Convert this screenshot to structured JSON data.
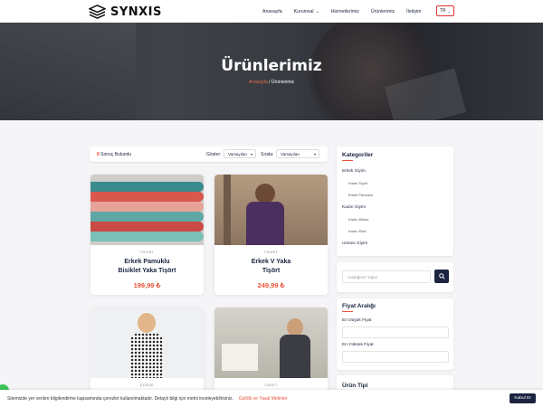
{
  "brand": {
    "name": "SYNXIS"
  },
  "nav": {
    "items": [
      {
        "label": "Anasayfa",
        "dropdown": false
      },
      {
        "label": "Kurumsal",
        "dropdown": true
      },
      {
        "label": "Hizmetlerimiz",
        "dropdown": false
      },
      {
        "label": "Ürünlerimiz",
        "dropdown": false
      },
      {
        "label": "İletişim",
        "dropdown": false
      }
    ],
    "language": "TR"
  },
  "hero": {
    "title": "Ürünlerimiz",
    "breadcrumb_home": "Anasayfa",
    "breadcrumb_sep": "/",
    "breadcrumb_current": "Ürünlerimiz"
  },
  "toolbar": {
    "result_count": "8",
    "result_label": "Sonuç Bulundu",
    "show_label": "Göster:",
    "show_value": "Varsayılan",
    "sort_label": "Sırala:",
    "sort_value": "Varsayılan"
  },
  "products": [
    {
      "category": "TSHIRT",
      "name_line1": "Erkek Pamuklu",
      "name_line2": "Bisiklet Yaka Tişört",
      "price": "199,99 ₺"
    },
    {
      "category": "TSHIRT",
      "name_line1": "Erkek V Yaka",
      "name_line2": "Tişört",
      "price": "249,99 ₺"
    },
    {
      "category": "ELBISE",
      "name_line1": "",
      "name_line2": "",
      "price": ""
    },
    {
      "category": "CEKET",
      "name_line1": "",
      "name_line2": "",
      "price": ""
    }
  ],
  "sidebar": {
    "categories_title": "Kategoriler",
    "categories": [
      {
        "label": "Erkek Giyim",
        "sub": false
      },
      {
        "label": "Erkek Tişört",
        "sub": true
      },
      {
        "label": "Erkek Pantolon",
        "sub": true
      },
      {
        "label": "Kadın Giyim",
        "sub": false
      },
      {
        "label": "Kadın Elbise",
        "sub": true
      },
      {
        "label": "Kadın Etek",
        "sub": true
      },
      {
        "label": "Unisex Giyim",
        "sub": false
      }
    ],
    "search_placeholder": "Aradığınız Yapın",
    "price_title": "Fiyat Aralığı",
    "min_price_label": "En Düşük Fiyat",
    "max_price_label": "En Yüksek Fiyat",
    "type_title": "Ürün Tipi"
  },
  "cookie": {
    "text": "Sitemizde yer verilen bilgilendirme kapsamında çerezler kullanılmaktadır. Detaylı bilgi için metni inceleyebilirsiniz.",
    "link": "Gizlilik ve Yasal Metinler",
    "button": "Kabul Et"
  },
  "colors": {
    "accent": "#e8543a",
    "navy": "#1b2440"
  }
}
